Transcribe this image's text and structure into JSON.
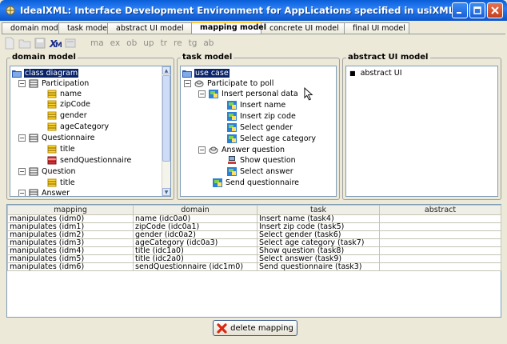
{
  "window": {
    "title": "IdealXML: Interface Development Environment for AppLications specified in usiXML"
  },
  "tabs": [
    {
      "label": "domain model"
    },
    {
      "label": "task model"
    },
    {
      "label": "abstract UI model"
    },
    {
      "label": "mapping model",
      "active": true
    },
    {
      "label": "concrete UI model"
    },
    {
      "label": "final UI model"
    }
  ],
  "toolbar": {
    "icons": [
      "new-icon",
      "open-icon",
      "save-icon",
      "xml-icon",
      "export-icon"
    ],
    "labels": [
      "ma",
      "ex",
      "ob",
      "up",
      "tr",
      "re",
      "tg",
      "ab"
    ]
  },
  "domain_panel": {
    "title": "domain model",
    "root": "class diagram",
    "nodes": [
      {
        "label": "Participation",
        "type": "class",
        "expanded": true
      },
      {
        "label": "name",
        "type": "attribute"
      },
      {
        "label": "zipCode",
        "type": "attribute"
      },
      {
        "label": "gender",
        "type": "attribute"
      },
      {
        "label": "ageCategory",
        "type": "attribute"
      },
      {
        "label": "Questionnaire",
        "type": "class",
        "expanded": true
      },
      {
        "label": "title",
        "type": "attribute"
      },
      {
        "label": "sendQuestionnaire",
        "type": "method"
      },
      {
        "label": "Question",
        "type": "class",
        "expanded": true
      },
      {
        "label": "title",
        "type": "attribute"
      },
      {
        "label": "Answer",
        "type": "class",
        "expanded": true
      }
    ]
  },
  "task_panel": {
    "title": "task model",
    "root": "use case",
    "nodes": [
      {
        "label": "Participate to poll",
        "type": "abstract-task",
        "expanded": true
      },
      {
        "label": "Insert personal data",
        "type": "interaction-task",
        "expanded": true
      },
      {
        "label": "Insert name",
        "type": "interaction-task"
      },
      {
        "label": "Insert zip code",
        "type": "interaction-task"
      },
      {
        "label": "Select gender",
        "type": "interaction-task"
      },
      {
        "label": "Select age category",
        "type": "interaction-task"
      },
      {
        "label": "Answer question",
        "type": "abstract-task",
        "expanded": true
      },
      {
        "label": "Show question",
        "type": "system-task"
      },
      {
        "label": "Select answer",
        "type": "interaction-task"
      },
      {
        "label": "Send questionnaire",
        "type": "interaction-task"
      }
    ]
  },
  "aui_panel": {
    "title": "abstract UI model",
    "items": [
      "abstract UI"
    ]
  },
  "mapping_table": {
    "columns": [
      "mapping",
      "domain",
      "task",
      "abstract"
    ],
    "rows": [
      [
        "manipulates (idm0)",
        "name (idc0a0)",
        "Insert name (task4)",
        ""
      ],
      [
        "manipulates (idm1)",
        "zipCode (idc0a1)",
        "Insert zip code (task5)",
        ""
      ],
      [
        "manipulates (idm2)",
        "gender (idc0a2)",
        "Select gender (task6)",
        ""
      ],
      [
        "manipulates (idm3)",
        "ageCategory (idc0a3)",
        "Select age category (task7)",
        ""
      ],
      [
        "manipulates (idm4)",
        "title (idc1a0)",
        "Show question (task8)",
        ""
      ],
      [
        "manipulates (idm5)",
        "title (idc2a0)",
        "Select answer (task9)",
        ""
      ],
      [
        "manipulates (idm6)",
        "sendQuestionnaire (idc1m0)",
        "Send questionnaire (task3)",
        ""
      ]
    ]
  },
  "delete_button": {
    "label": "delete mapping"
  },
  "colors": {
    "selection": "#0a246a",
    "titlebar": "#0a5fd8",
    "active_tab_accent": "#ffc83c"
  }
}
